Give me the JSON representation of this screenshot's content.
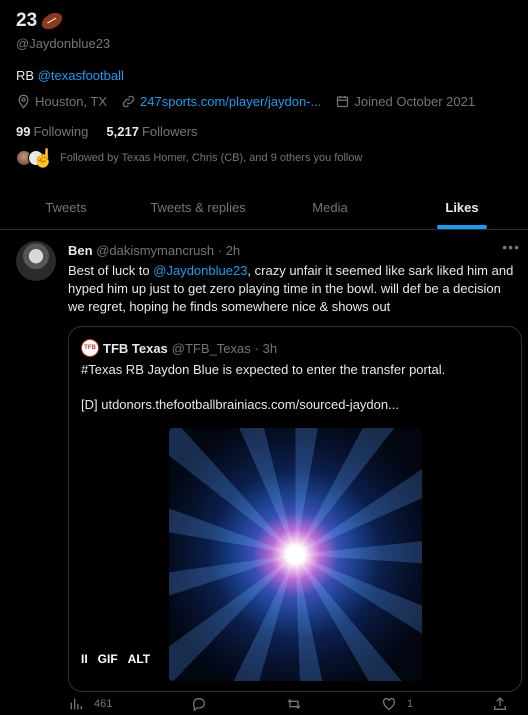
{
  "profile": {
    "name": "23",
    "handle": "@Jaydonblue23",
    "bio_prefix": "RB",
    "bio_link": "@texasfootball",
    "location": "Houston, TX",
    "website": "247sports.com/player/jaydon-...",
    "joined": "Joined October 2021",
    "following_count": "99",
    "following_label": "Following",
    "followers_count": "5,217",
    "followers_label": "Followers",
    "followed_by": "Followed by Texas Homer, Chris (CB), and 9 others you follow"
  },
  "tabs": [
    {
      "label": "Tweets"
    },
    {
      "label": "Tweets & replies"
    },
    {
      "label": "Media"
    },
    {
      "label": "Likes"
    }
  ],
  "tweet": {
    "author": "Ben",
    "handle": "@dakismymancrush",
    "time": "· 2h",
    "text_pre": "Best of luck to ",
    "mention": "@Jaydonblue23",
    "text_post": ", crazy unfair it seemed like sark liked him and hyped him up just to get zero playing time in the bowl. will def be a decision we regret, hoping he finds somewhere nice & shows out",
    "quote": {
      "logo_text": "TFB",
      "author": "TFB Texas",
      "handle": "@TFB_Texas",
      "time": "· 3h",
      "text": "#Texas RB Jaydon Blue is expected to enter the transfer portal.",
      "link": "[D] utdonors.thefootballbrainiacs.com/sourced-jaydon...",
      "gif_pause": "II",
      "gif_label": "GIF",
      "alt_label": "ALT"
    },
    "stats": {
      "views": "461",
      "likes": "1"
    }
  },
  "colors": {
    "accent": "#1d9bf0",
    "background": "#000000",
    "muted": "#71767b"
  }
}
